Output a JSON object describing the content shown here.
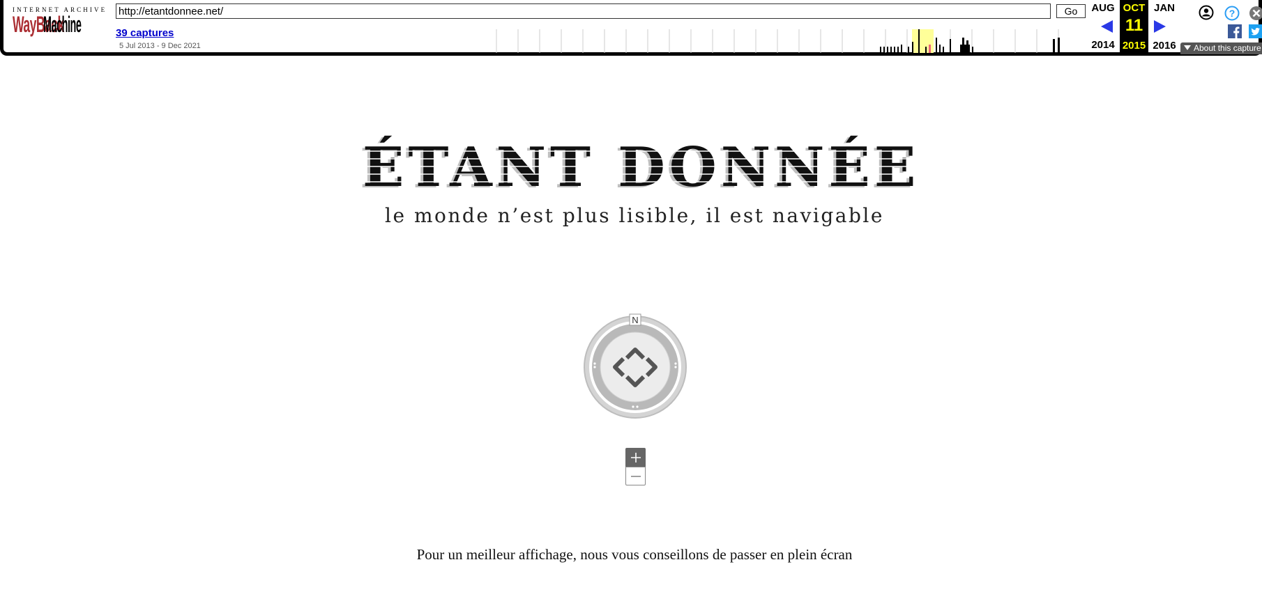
{
  "wayback": {
    "logo_top": "INTERNET ARCHIVE",
    "logo_way": "WayBack",
    "logo_machine": "Machine",
    "url_value": "http://etantdonnee.net/",
    "go_label": "Go",
    "captures_label": "39 captures",
    "date_range": "5 Jul 2013 - 9 Dec 2021",
    "prev_month": "AUG",
    "prev_year": "2014",
    "current_month": "OCT",
    "current_day": "11",
    "current_year": "2015",
    "next_month": "JAN",
    "next_year": "2016",
    "about_label": "About this capture",
    "accent_color": "#2a39e6",
    "highlight_color": "#ffff00"
  },
  "page": {
    "title": "ÉTANT DONNÉE",
    "tagline": "le monde n’est plus lisible, il est navigable",
    "compass_north": "N",
    "zoom_in": "+",
    "zoom_out": "—",
    "fullscreen_note": "Pour un meilleur affichage, nous vous conseillons de passer en plein écran"
  }
}
